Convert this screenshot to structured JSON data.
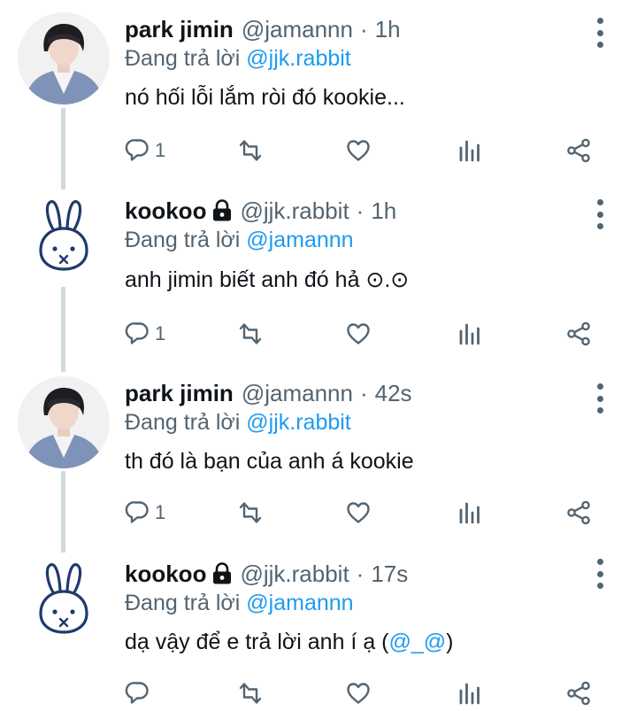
{
  "tweets": [
    {
      "name": "park jimin",
      "handle": "@jamannn",
      "separator": "·",
      "time": "1h",
      "reply_prefix": "Đang trả lời ",
      "reply_to": "@jjk.rabbit",
      "text": "nó hối lỗi lắm ròi đó kookie...",
      "reply_count": "1",
      "avatar": "photo-avatar",
      "locked": false
    },
    {
      "name": "kookoo",
      "handle": "@jjk.rabbit",
      "separator": "·",
      "time": "1h",
      "reply_prefix": "Đang trả lời ",
      "reply_to": "@jamannn",
      "text": "anh jimin biết anh đó hả ⊙.⊙",
      "reply_count": "1",
      "avatar": "rabbit-avatar",
      "locked": true
    },
    {
      "name": "park jimin",
      "handle": "@jamannn",
      "separator": "·",
      "time": "42s",
      "reply_prefix": "Đang trả lời ",
      "reply_to": "@jjk.rabbit",
      "text": "th đó là bạn của anh á kookie",
      "reply_count": "1",
      "avatar": "photo-avatar",
      "locked": false
    },
    {
      "name": "kookoo",
      "handle": "@jjk.rabbit",
      "separator": "·",
      "time": "17s",
      "reply_prefix": "Đang trả lời ",
      "reply_to": "@jamannn",
      "text_parts": [
        "dạ vậy để e trả lời anh í ạ (",
        "@_@",
        ")"
      ],
      "reply_count": "",
      "avatar": "rabbit-avatar",
      "locked": true
    }
  ],
  "colors": {
    "text": "#0f1419",
    "secondary": "#536471",
    "mention": "#1d9bf0",
    "thread_line": "#cfd9de"
  },
  "icons": [
    "comment-icon",
    "retweet-icon",
    "like-icon",
    "views-icon",
    "share-icon",
    "more-icon",
    "lock-icon"
  ]
}
